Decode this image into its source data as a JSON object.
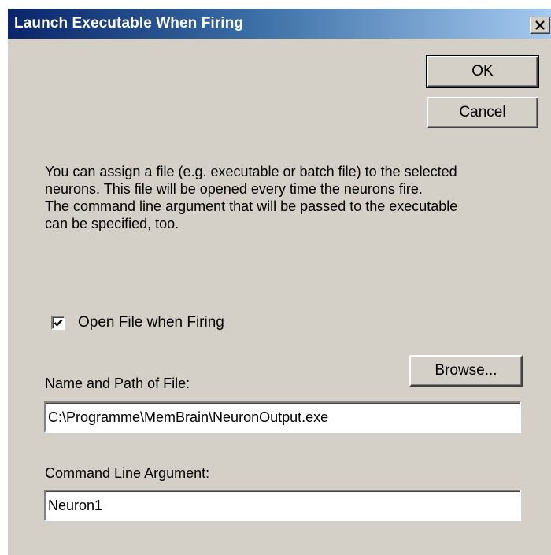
{
  "window": {
    "title": "Launch Executable When Firing",
    "close_glyph": "✕"
  },
  "buttons": {
    "ok": "OK",
    "cancel": "Cancel",
    "browse": "Browse..."
  },
  "description": {
    "line1": "You can assign a file (e.g. executable or batch file) to the selected",
    "line2": "neurons. This file will be opened every time the neurons fire.",
    "line3": "The command line argument that will be passed to the executable",
    "line4": "can be specified, too."
  },
  "checkbox": {
    "label": "Open File when Firing",
    "checked": true
  },
  "file_path": {
    "label": "Name and Path of File:",
    "value": "C:\\Programme\\MemBrain\\NeuronOutput.exe"
  },
  "command_arg": {
    "label": "Command Line Argument:",
    "value": "Neuron1"
  },
  "icons": {
    "close": "close-icon",
    "check": "checkmark-icon"
  }
}
